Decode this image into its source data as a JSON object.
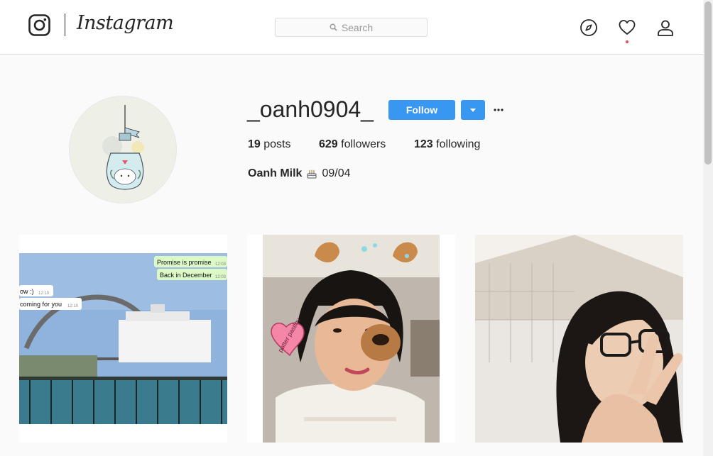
{
  "header": {
    "logo_text": "Instagram",
    "search_placeholder": "Search"
  },
  "profile": {
    "username": "_oanh0904_",
    "follow_label": "Follow",
    "posts_count": "19",
    "posts_label": "posts",
    "followers_count": "629",
    "followers_label": "followers",
    "following_count": "123",
    "following_label": "following",
    "full_name": "Oanh Milk",
    "bio_date": "09/04"
  },
  "post1": {
    "bubble_1": "Promise is promise",
    "bubble_1_time": "12:03",
    "bubble_2": "Back in December",
    "bubble_2_time": "12:03",
    "bubble_3": "ow :)",
    "bubble_3_time": "12:10",
    "bubble_4": "coming for you",
    "bubble_4_time": "12:10"
  },
  "post2": {
    "sticker_text": "patter pastlov"
  },
  "icons": [
    "instagram-camera-icon",
    "search-icon",
    "compass-icon",
    "heart-icon",
    "person-icon",
    "chevron-down-icon",
    "more-icon",
    "cake-icon"
  ],
  "colors": {
    "accent": "#3897f0",
    "notification": "#ed4956",
    "text": "#262626",
    "border": "#dbdbdb"
  }
}
